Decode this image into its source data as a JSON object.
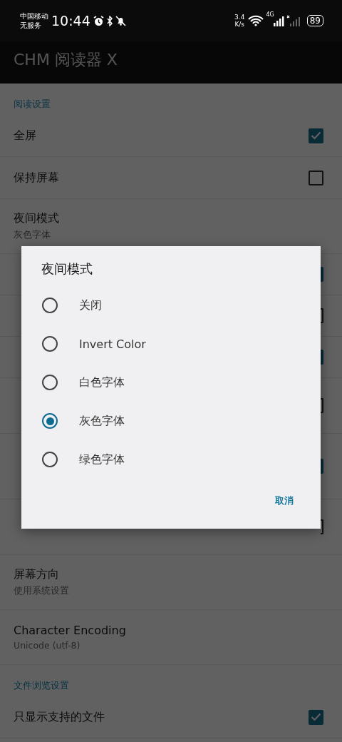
{
  "status_bar": {
    "carrier": "中国移动",
    "service": "无服务",
    "time": "10:44",
    "speed_value": "3.4",
    "speed_unit": "K/s",
    "network": "4G",
    "battery": "89"
  },
  "app_bar": {
    "title": "CHM 阅读器 X"
  },
  "sections": [
    {
      "title": "阅读设置",
      "rows": [
        {
          "kind": "checkbox",
          "title": "全屏",
          "checked": true
        },
        {
          "kind": "checkbox",
          "title": "保持屏幕",
          "checked": false
        },
        {
          "kind": "text",
          "title": "夜间模式",
          "summary": "灰色字体"
        },
        {
          "kind": "covered",
          "checked": true
        },
        {
          "kind": "covered",
          "checked": false
        },
        {
          "kind": "covered",
          "checked": true
        },
        {
          "kind": "covered",
          "checked": false
        },
        {
          "kind": "covered",
          "checked": true
        },
        {
          "kind": "covered",
          "checked": false
        },
        {
          "kind": "text",
          "title": "屏幕方向",
          "summary": "使用系统设置"
        },
        {
          "kind": "text",
          "title": "Character Encoding",
          "summary": "Unicode (utf-8)"
        }
      ]
    },
    {
      "title": "文件浏览设置",
      "rows": [
        {
          "kind": "checkbox",
          "title": "只显示支持的文件",
          "checked": true
        }
      ]
    }
  ],
  "dialog": {
    "title": "夜间模式",
    "options": [
      {
        "label": "关闭",
        "selected": false
      },
      {
        "label": "Invert Color",
        "selected": false
      },
      {
        "label": "白色字体",
        "selected": false
      },
      {
        "label": "灰色字体",
        "selected": true
      },
      {
        "label": "绿色字体",
        "selected": false
      }
    ],
    "cancel": "取消"
  }
}
